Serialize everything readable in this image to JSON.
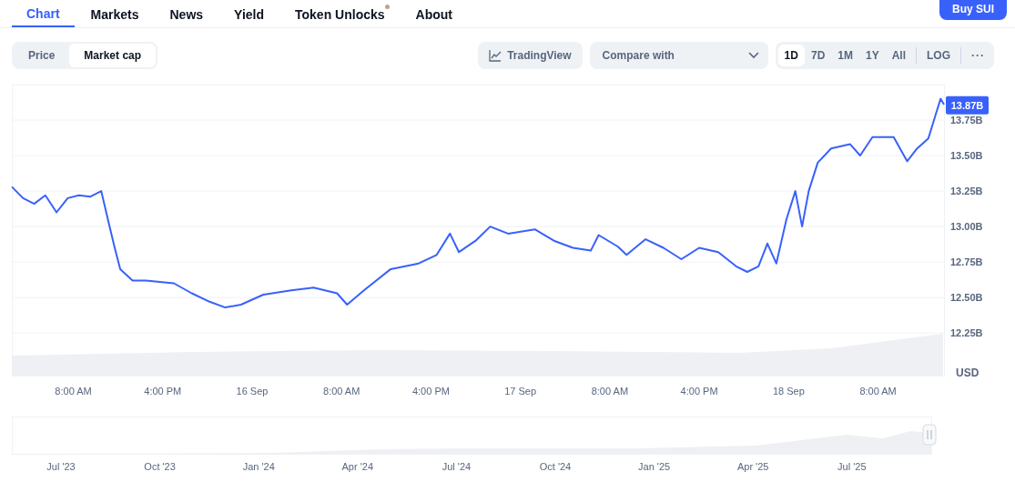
{
  "nav_tabs": [
    {
      "label": "Chart",
      "selected": true,
      "dot": false
    },
    {
      "label": "Markets",
      "selected": false,
      "dot": false
    },
    {
      "label": "News",
      "selected": false,
      "dot": false
    },
    {
      "label": "Yield",
      "selected": false,
      "dot": false
    },
    {
      "label": "Token Unlocks",
      "selected": false,
      "dot": true
    },
    {
      "label": "About",
      "selected": false,
      "dot": false
    }
  ],
  "buy_button": "Buy SUI",
  "chart_type_toggle": [
    {
      "label": "Price",
      "selected": false
    },
    {
      "label": "Market cap",
      "selected": true
    }
  ],
  "tradingview_button": "TradingView",
  "compare_select": {
    "placeholder": "Compare with"
  },
  "range_buttons": [
    {
      "label": "1D",
      "selected": true
    },
    {
      "label": "7D",
      "selected": false
    },
    {
      "label": "1M",
      "selected": false
    },
    {
      "label": "1Y",
      "selected": false
    },
    {
      "label": "All",
      "selected": false
    }
  ],
  "log_button": "LOG",
  "more_button": "···",
  "chart": {
    "current_value_label": "13.87B",
    "currency": "USD",
    "chart_data": {
      "type": "line",
      "grid": true,
      "xlim": [
        "2025-09-15T02:30",
        "2025-09-18T13:54"
      ],
      "xticks": [
        {
          "value": "2025-09-15T08:00",
          "label": "8:00 AM"
        },
        {
          "value": "2025-09-15T16:00",
          "label": "4:00 PM"
        },
        {
          "value": "2025-09-16T00:00",
          "label": "16 Sep"
        },
        {
          "value": "2025-09-16T08:00",
          "label": "8:00 AM"
        },
        {
          "value": "2025-09-16T16:00",
          "label": "4:00 PM"
        },
        {
          "value": "2025-09-17T00:00",
          "label": "17 Sep"
        },
        {
          "value": "2025-09-17T08:00",
          "label": "8:00 AM"
        },
        {
          "value": "2025-09-17T16:00",
          "label": "4:00 PM"
        },
        {
          "value": "2025-09-18T00:00",
          "label": "18 Sep"
        },
        {
          "value": "2025-09-18T08:00",
          "label": "8:00 AM"
        }
      ],
      "ylim": [
        11950000000,
        14000000000
      ],
      "yticks": [
        {
          "value": 12250000000,
          "label": "12.25B"
        },
        {
          "value": 12500000000,
          "label": "12.50B"
        },
        {
          "value": 12750000000,
          "label": "12.75B"
        },
        {
          "value": 13000000000,
          "label": "13.00B"
        },
        {
          "value": 13250000000,
          "label": "13.25B"
        },
        {
          "value": 13500000000,
          "label": "13.50B"
        },
        {
          "value": 13750000000,
          "label": "13.75B"
        }
      ],
      "x": [
        "2025-09-15T02:30",
        "2025-09-15T03:30",
        "2025-09-15T04:30",
        "2025-09-15T05:30",
        "2025-09-15T06:30",
        "2025-09-15T07:30",
        "2025-09-15T08:30",
        "2025-09-15T09:30",
        "2025-09-15T10:30",
        "2025-09-15T11:00",
        "2025-09-15T11:42",
        "2025-09-15T12:12",
        "2025-09-15T13:18",
        "2025-09-15T14:30",
        "2025-09-15T17:00",
        "2025-09-15T18:36",
        "2025-09-15T20:12",
        "2025-09-15T21:36",
        "2025-09-15T23:00",
        "2025-09-16T01:00",
        "2025-09-16T03:30",
        "2025-09-16T05:30",
        "2025-09-16T07:36",
        "2025-09-16T08:30",
        "2025-09-16T10:00",
        "2025-09-16T12:24",
        "2025-09-16T14:54",
        "2025-09-16T16:30",
        "2025-09-16T17:42",
        "2025-09-16T18:30",
        "2025-09-16T20:00",
        "2025-09-16T21:18",
        "2025-09-16T22:54",
        "2025-09-17T01:18",
        "2025-09-17T03:00",
        "2025-09-17T04:42",
        "2025-09-17T06:18",
        "2025-09-17T07:00",
        "2025-09-17T08:42",
        "2025-09-17T09:30",
        "2025-09-17T11:12",
        "2025-09-17T12:48",
        "2025-09-17T14:24",
        "2025-09-17T16:00",
        "2025-09-17T17:42",
        "2025-09-17T19:18",
        "2025-09-17T20:18",
        "2025-09-17T21:18",
        "2025-09-17T22:06",
        "2025-09-17T22:54",
        "2025-09-17T23:48",
        "2025-09-18T00:36",
        "2025-09-18T01:12",
        "2025-09-18T01:48",
        "2025-09-18T02:36",
        "2025-09-18T03:48",
        "2025-09-18T05:30",
        "2025-09-18T06:24",
        "2025-09-18T07:30",
        "2025-09-18T09:24",
        "2025-09-18T10:36",
        "2025-09-18T11:30",
        "2025-09-18T12:30",
        "2025-09-18T13:12",
        "2025-09-18T13:36",
        "2025-09-18T13:54"
      ],
      "series": [
        {
          "color": "#3861fb",
          "values": [
            13280000000,
            13200000000,
            13160000000,
            13220000000,
            13100000000,
            13200000000,
            13220000000,
            13210000000,
            13250000000,
            13080000000,
            12850000000,
            12700000000,
            12620000000,
            12620000000,
            12600000000,
            12530000000,
            12470000000,
            12430000000,
            12450000000,
            12520000000,
            12550000000,
            12570000000,
            12530000000,
            12450000000,
            12550000000,
            12700000000,
            12740000000,
            12800000000,
            12950000000,
            12820000000,
            12900000000,
            13000000000,
            12950000000,
            12980000000,
            12900000000,
            12850000000,
            12830000000,
            12940000000,
            12860000000,
            12800000000,
            12910000000,
            12850000000,
            12770000000,
            12850000000,
            12820000000,
            12720000000,
            12680000000,
            12720000000,
            12880000000,
            12740000000,
            13050000000,
            13250000000,
            13000000000,
            13250000000,
            13450000000,
            13550000000,
            13580000000,
            13500000000,
            13630000000,
            13630000000,
            13460000000,
            13550000000,
            13620000000,
            13800000000,
            13900000000,
            13860000000
          ]
        }
      ]
    }
  },
  "navigator": {
    "labels": [
      "Jul '23",
      "Oct '23",
      "Jan '24",
      "Apr '24",
      "Jul '24",
      "Oct '24",
      "Jan '25",
      "Apr '25",
      "Jul '25"
    ]
  }
}
